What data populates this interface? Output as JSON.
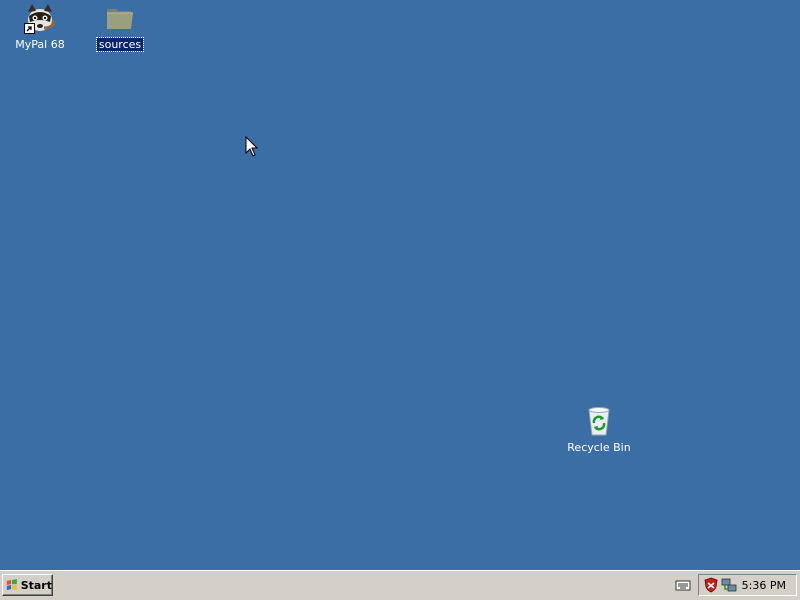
{
  "desktop": {
    "background_color": "#3a6ea5",
    "icons": [
      {
        "label": "MyPal 68",
        "icon": "mypal-raccoon-icon",
        "shortcut": true,
        "selected": false
      },
      {
        "label": "sources",
        "icon": "folder-icon",
        "shortcut": false,
        "selected": true
      },
      {
        "label": "Recycle Bin",
        "icon": "recycle-bin-icon",
        "shortcut": false,
        "selected": false
      }
    ]
  },
  "taskbar": {
    "start_label": "Start",
    "tray": {
      "icons": [
        "keyboard-icon",
        "security-shield-icon",
        "network-icon"
      ],
      "clock": "5:36 PM"
    }
  }
}
